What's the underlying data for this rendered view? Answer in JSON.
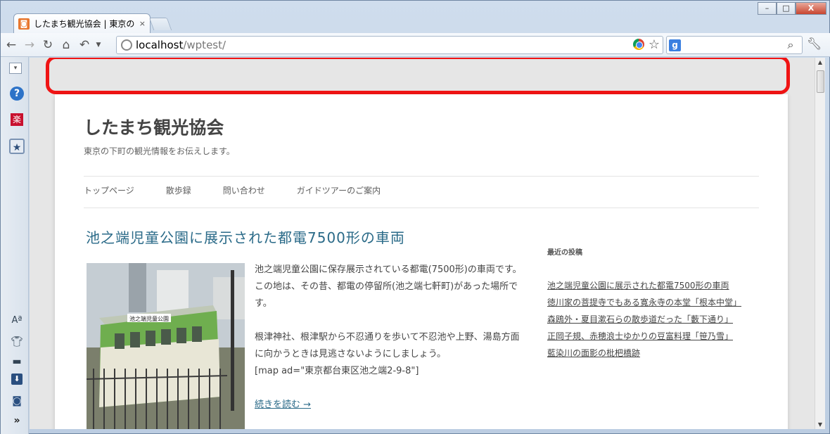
{
  "browser": {
    "tab_title": "したまち観光協会 | 東京の",
    "tab_close": "×",
    "url_host": "localhost",
    "url_path": "/wptest/",
    "search_engine_icon": "g",
    "window_controls": [
      "–",
      "□",
      "X"
    ]
  },
  "sidebar": {
    "items": [
      "dropdown-icon",
      "help-icon",
      "rakuten-icon",
      "bookmark-star-icon",
      "font-icon",
      "shirt-icon",
      "print-icon",
      "download-icon",
      "camera-icon",
      "more-icon"
    ],
    "help_label": "?",
    "raku_label": "楽",
    "more_label": "»"
  },
  "site": {
    "title": "したまち観光協会",
    "description": "東京の下町の観光情報をお伝えします。",
    "nav": [
      "トップページ",
      "散歩録",
      "問い合わせ",
      "ガイドツアーのご案内"
    ]
  },
  "post": {
    "title": "池之端児童公園に展示された都電7500形の車両",
    "paragraph1": "池之端児童公園に保存展示されている都電(7500形)の車両です。この地は、その昔、都電の停留所(池之端七軒町)があった場所です。",
    "paragraph2a": "根津神社、根津駅から不忍通りを歩いて不忍池や上野、湯島方面に向かうときは見逃さないようにしましょう。",
    "paragraph2b": "[map ad=\"東京都台東区池之端2-9-8\"]",
    "read_more": "続きを読む →",
    "image_sign": "池之端児童公園"
  },
  "widget": {
    "title": "最近の投稿",
    "items": [
      "池之端児童公園に展示された都電7500形の車両",
      "徳川家の菩提寺でもある寛永寺の本堂「根本中堂」",
      "森鴎外・夏目漱石らの散歩道だった「藪下通り」",
      "正岡子規、赤穂浪士ゆかりの豆富料理「笹乃雪」",
      "藍染川の面影の枇杷橋跡"
    ]
  },
  "colors": {
    "highlight": "#f01414",
    "link": "#2a6a88"
  }
}
